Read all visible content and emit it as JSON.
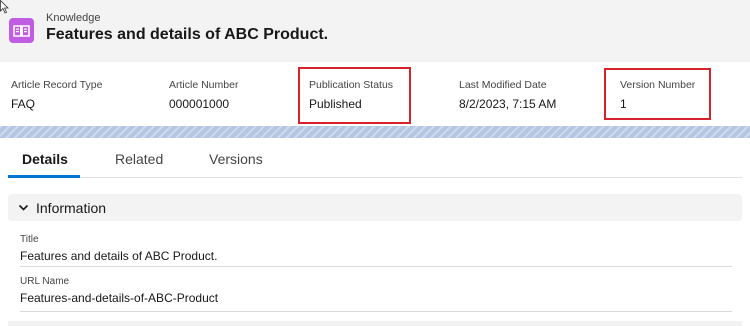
{
  "header": {
    "object_label": "Knowledge",
    "title": "Features and details of ABC Product.",
    "icon": "knowledge-book-icon",
    "icon_color": "#c05de2"
  },
  "highlights": [
    {
      "label": "Article Record Type",
      "value": "FAQ"
    },
    {
      "label": "Article Number",
      "value": "000001000"
    },
    {
      "label": "Publication Status",
      "value": "Published"
    },
    {
      "label": "Last Modified Date",
      "value": "8/2/2023, 7:15 AM"
    },
    {
      "label": "Version Number",
      "value": "1"
    }
  ],
  "tabs": [
    {
      "label": "Details",
      "active": true
    },
    {
      "label": "Related",
      "active": false
    },
    {
      "label": "Versions",
      "active": false
    }
  ],
  "section": {
    "label": "Information",
    "expanded": true
  },
  "fields": [
    {
      "label": "Title",
      "value": "Features and details of ABC Product."
    },
    {
      "label": "URL Name",
      "value": "Features-and-details-of-ABC-Product"
    }
  ],
  "colors": {
    "highlight_box": "#d6222a",
    "active_tab": "#0176d3",
    "band": "#b4c7e2"
  }
}
